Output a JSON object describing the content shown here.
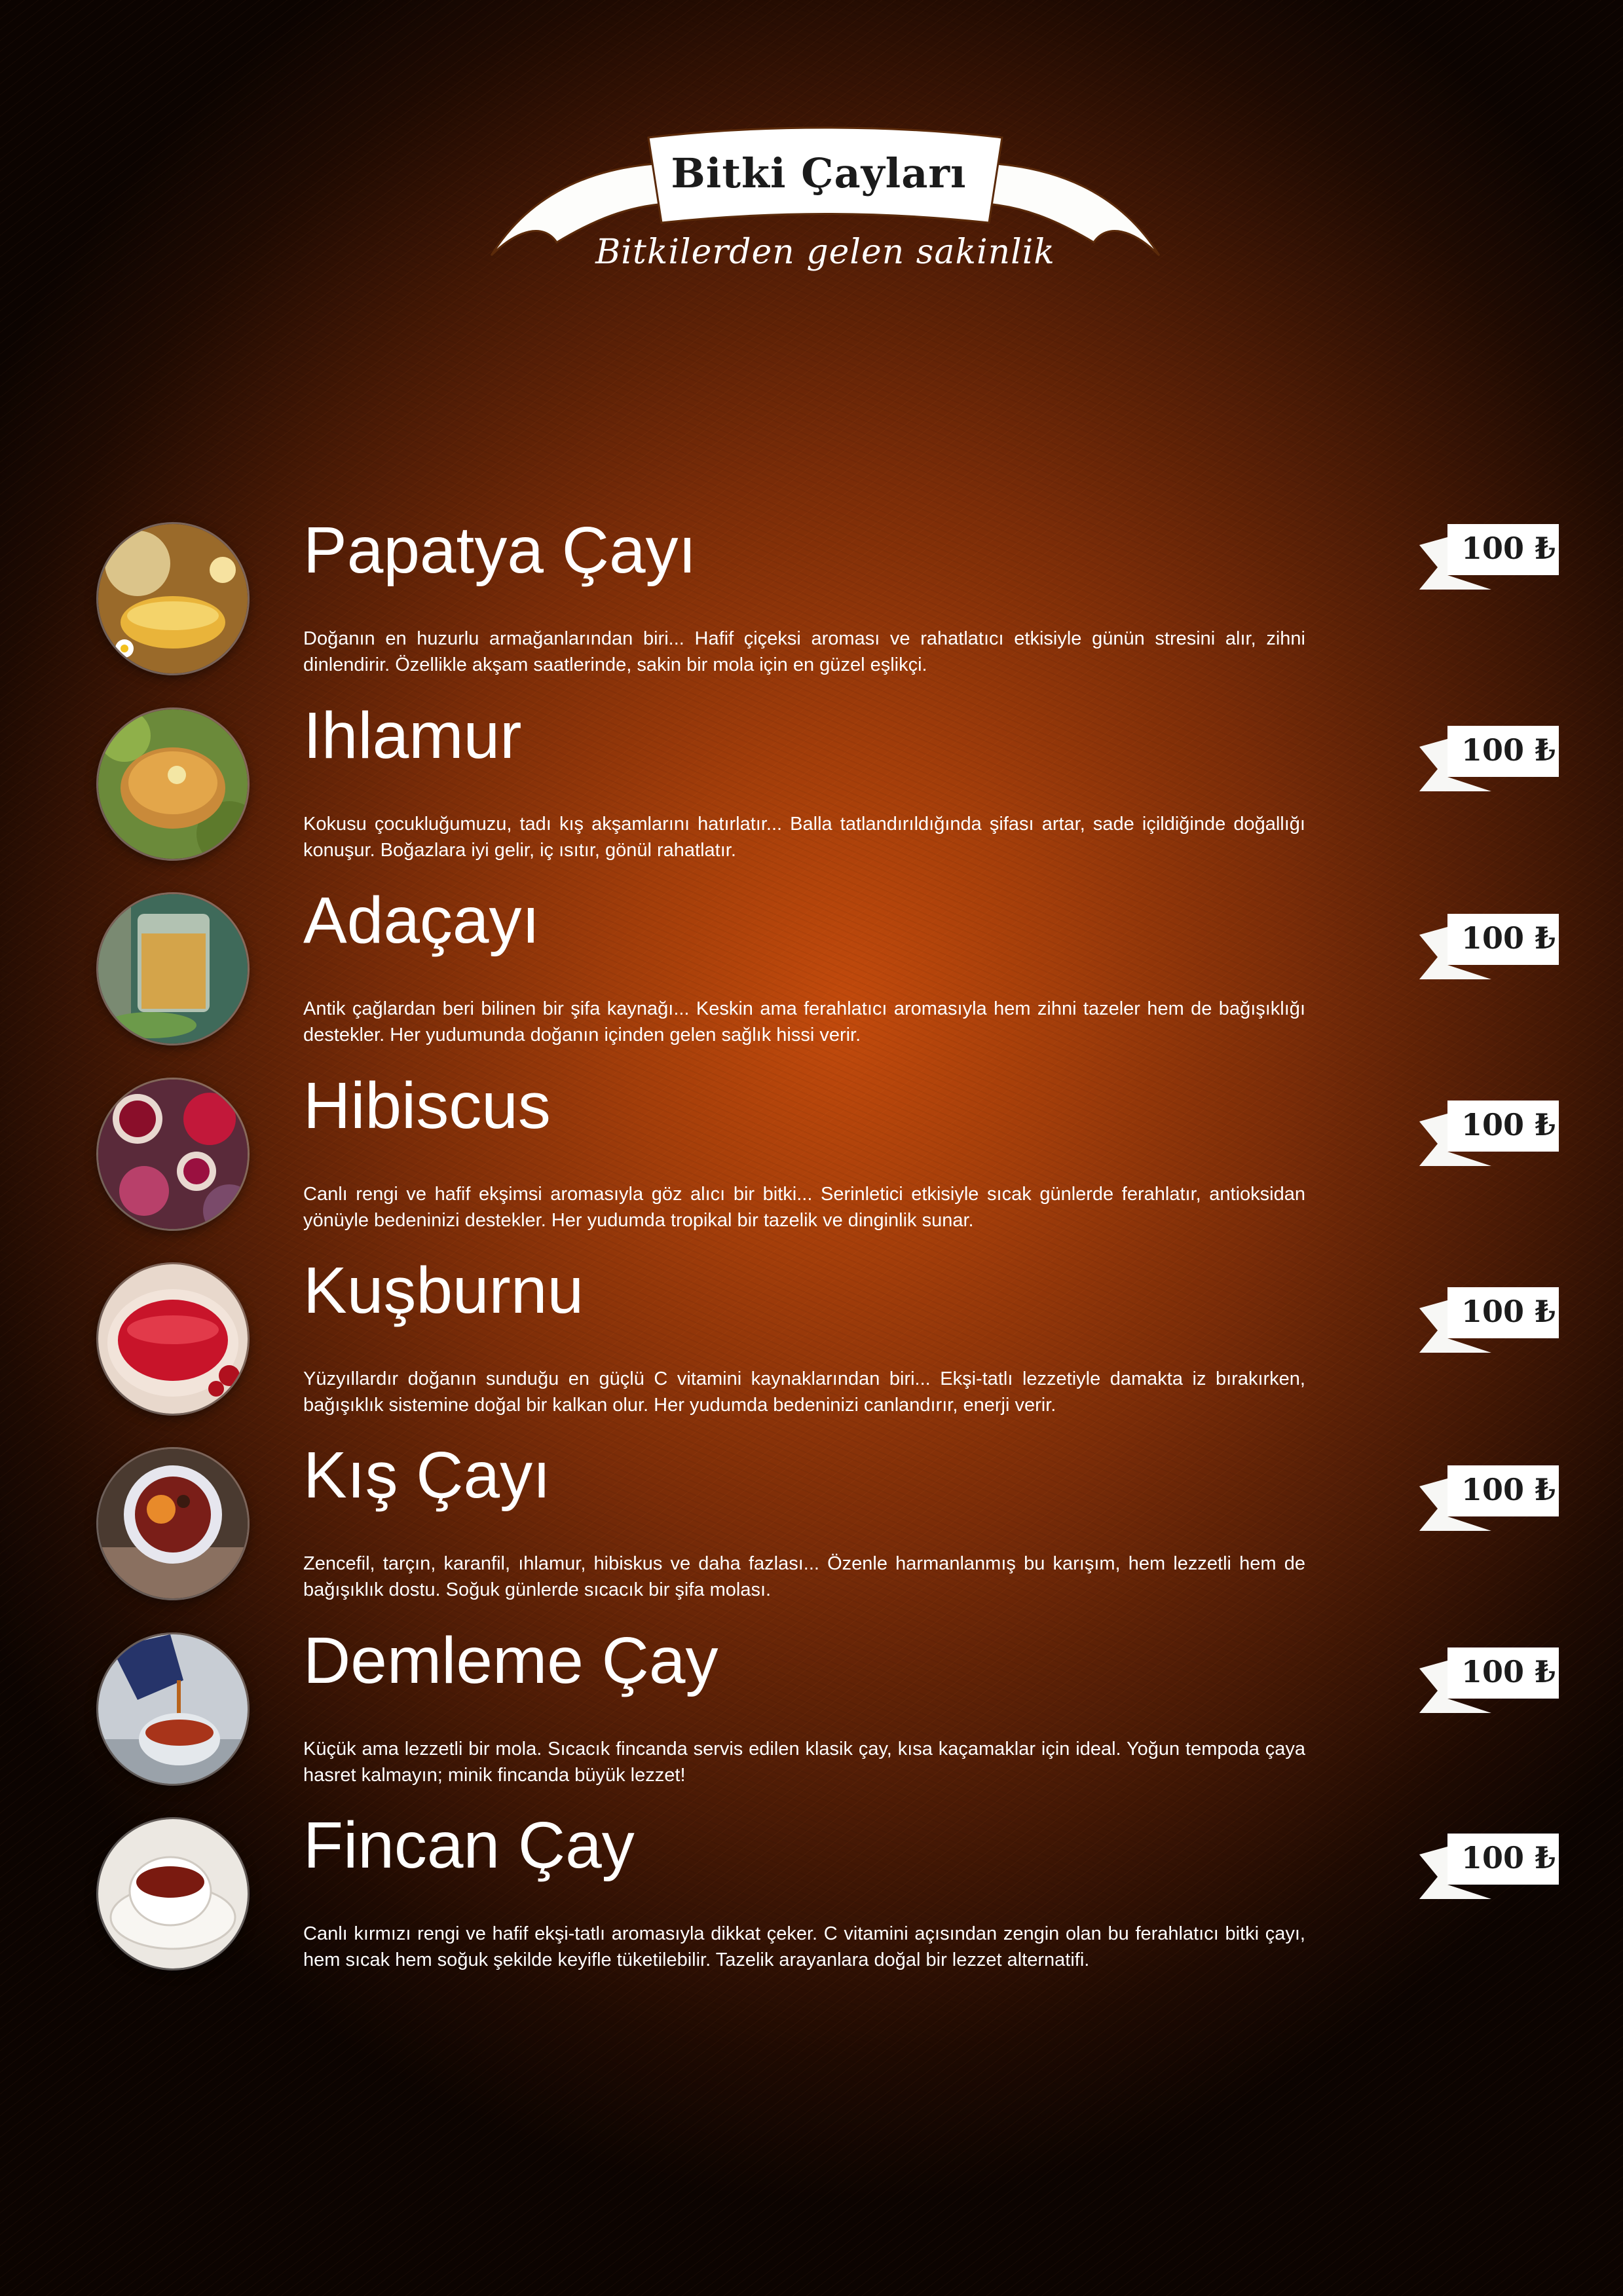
{
  "header": {
    "title": "Bitki Çayları",
    "subtitle": "Bitkilerden gelen sakinlik"
  },
  "items": [
    {
      "name": "Papatya Çayı",
      "description": "Doğanın en huzurlu armağanlarından biri... Hafif çiçeksi aroması ve rahatlatıcı etkisiyle günün stresini alır, zihni dinlendirir. Özellikle akşam saatlerinde, sakin bir mola için en güzel eşlikçi.",
      "price": "100 ₺",
      "image_icon": "chamomile-tea-photo"
    },
    {
      "name": "Ihlamur",
      "description": "Kokusu çocukluğumuzu, tadı kış akşamlarını hatırlatır... Balla tatlandırıldığında şifası artar, sade içildiğinde doğallığı konuşur. Boğazlara iyi gelir, iç ısıtır, gönül rahatlatır.",
      "price": "100 ₺",
      "image_icon": "linden-tea-photo"
    },
    {
      "name": "Adaçayı",
      "description": "Antik çağlardan beri bilinen bir şifa kaynağı... Keskin ama ferahlatıcı aromasıyla hem zihni tazeler hem de bağışıklığı destekler. Her yudumunda doğanın içinden gelen sağlık hissi verir.",
      "price": "100 ₺",
      "image_icon": "sage-tea-photo"
    },
    {
      "name": "Hibiscus",
      "description": "Canlı rengi ve hafif ekşimsi aromasıyla göz alıcı bir bitki... Serinletici etkisiyle sıcak günlerde ferahlatır, antioksidan yönüyle bedeninizi destekler. Her yudumda tropikal bir tazelik ve dinginlik sunar.",
      "price": "100 ₺",
      "image_icon": "hibiscus-tea-photo"
    },
    {
      "name": "Kuşburnu",
      "description": "Yüzyıllardır doğanın sunduğu en güçlü C vitamini kaynaklarından biri... Ekşi-tatlı lezzetiyle damakta iz bırakırken, bağışıklık sistemine doğal bir kalkan olur. Her yudumda bedeninizi canlandırır, enerji verir.",
      "price": "100 ₺",
      "image_icon": "rosehip-tea-photo"
    },
    {
      "name": "Kış Çayı",
      "description": "Zencefil, tarçın, karanfil, ıhlamur, hibiskus ve daha fazlası... Özenle harmanlanmış bu karışım, hem lezzetli hem de bağışıklık dostu. Soğuk günlerde sıcacık bir şifa molası.",
      "price": "100 ₺",
      "image_icon": "winter-tea-photo"
    },
    {
      "name": "Demleme Çay",
      "description": "Küçük ama lezzetli bir mola. Sıcacık fincanda servis edilen klasik çay, kısa kaçamaklar için ideal. Yoğun tempoda çaya hasret kalmayın; minik fincanda büyük lezzet!",
      "price": "100 ₺",
      "image_icon": "brewed-tea-photo"
    },
    {
      "name": "Fincan Çay",
      "description": "Canlı kırmızı rengi ve hafif ekşi-tatlı aromasıyla dikkat çeker. C vitamini açısından zengin olan bu ferahlatıcı bitki çayı, hem sıcak hem soğuk şekilde keyifle tüketilebilir. Tazelik arayanlara doğal bir lezzet alternatifi.",
      "price": "100 ₺",
      "image_icon": "cup-tea-photo"
    }
  ]
}
